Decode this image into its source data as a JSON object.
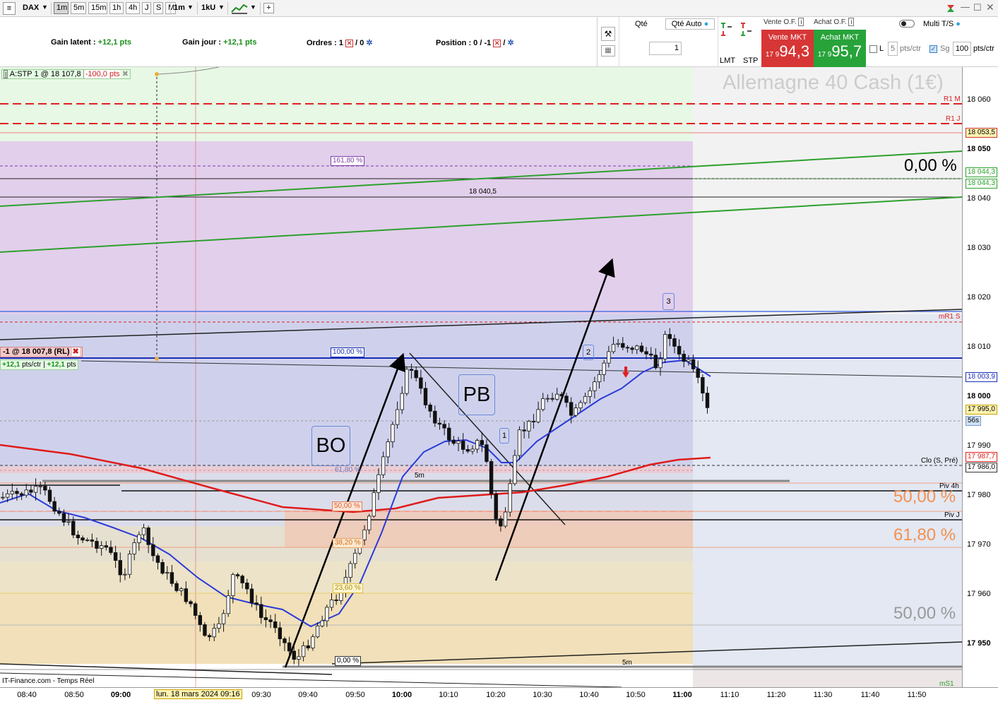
{
  "toolbar": {
    "symbol": "DAX",
    "timeframes": [
      "1m",
      "5m",
      "15m",
      "1h",
      "4h",
      "J",
      "S",
      "M"
    ],
    "selected_timeframe": "1m",
    "period": "1m",
    "units": "1kU"
  },
  "infobar": {
    "gain_latent_label": "Gain latent :",
    "gain_latent_value": "+12,1 pts",
    "gain_jour_label": "Gain jour :",
    "gain_jour_value": "+12,1 pts",
    "ordres_label": "Ordres :",
    "ordres_value": "1",
    "ordres_total": "/ 0",
    "position_label": "Position :",
    "position_value": "0",
    "position_other": "/ -1",
    "position_sep": "/"
  },
  "orderpanel": {
    "qte_label": "Qté",
    "qte_auto_label": "Qté Auto",
    "qte_value": "1",
    "lmt_label": "LMT",
    "stp_label": "STP",
    "vente_label": "Vente O.F.",
    "achat_label": "Achat O.F.",
    "vente_mkt_label": "Vente MKT",
    "achat_mkt_label": "Achat MKT",
    "vente_prefix": "17 9",
    "vente_price": "94,3",
    "achat_prefix": "17 9",
    "achat_price": "95,7",
    "multi_label": "Multi T/S",
    "l_label": "L",
    "l_value": "5",
    "pts_ctr": "pts/ctr",
    "sg_label": "Sg",
    "sg_value": "100",
    "sg_unit": "pts/ctr"
  },
  "chart": {
    "instrument_title": "Allemagne 40 Cash (1€)",
    "source": "IT-Finance.com - Temps Réel",
    "stop_order_label": "A:STP 1 @ 18 107,8",
    "stop_order_pts": "-100,0 pts",
    "position_label": "-1 @ 18 007,8 (RL)",
    "position_pnl1": "+12,1",
    "position_pnl1_unit": "pts/ctr",
    "position_pnl2": "+12,1",
    "position_pnl2_unit": "pts",
    "annotation_bo": "BO",
    "annotation_pb": "PB",
    "wave_labels": [
      "1",
      "2",
      "3"
    ],
    "pct_right_top": "0,00 %",
    "pct_right_50_orange": "50,00 %",
    "pct_right_618_orange": "61,80 %",
    "pct_right_50_gray": "50,00 %",
    "line_label_18040": "18 040,5",
    "fib_labels": [
      "161,80 %",
      "100,00 %",
      "61,80 %",
      "50,00 %",
      "38,20 %",
      "23,60 %",
      "0,00 %"
    ],
    "label_5m_1": "5m",
    "label_5m_2": "5m",
    "r1m": "R1 M",
    "r1j": "R1 J",
    "mr1s": "mR1 S",
    "clo": "Clo (S, Pré)",
    "piv4h": "Piv 4h",
    "pivj": "Piv J",
    "ms1": "mS1"
  },
  "price_axis": {
    "ticks": [
      "18 060",
      "18 050",
      "18 040",
      "18 030",
      "18 020",
      "18 010",
      "18 000",
      "17 990",
      "17 980",
      "17 970",
      "17 960",
      "17 950"
    ],
    "tags": [
      "18 053,5",
      "18 044,3",
      "18 044,3",
      "18 003,9",
      "17 995,0",
      "56s",
      "17 987,7",
      "17 986,0"
    ]
  },
  "time_axis": {
    "ticks": [
      "08:40",
      "08:50",
      "09:00",
      "09:30",
      "09:40",
      "09:50",
      "10:00",
      "10:10",
      "10:20",
      "10:30",
      "10:40",
      "10:50",
      "11:00",
      "11:10",
      "11:20",
      "11:30",
      "11:40",
      "11:50"
    ],
    "cursor_label": "lun. 18 mars 2024 09:16"
  },
  "colors": {
    "vente": "#d73636",
    "achat": "#27a33a",
    "ema_blue": "#2b3bd8",
    "ema_red": "#e01b1b",
    "trend_green": "#2da02d"
  }
}
